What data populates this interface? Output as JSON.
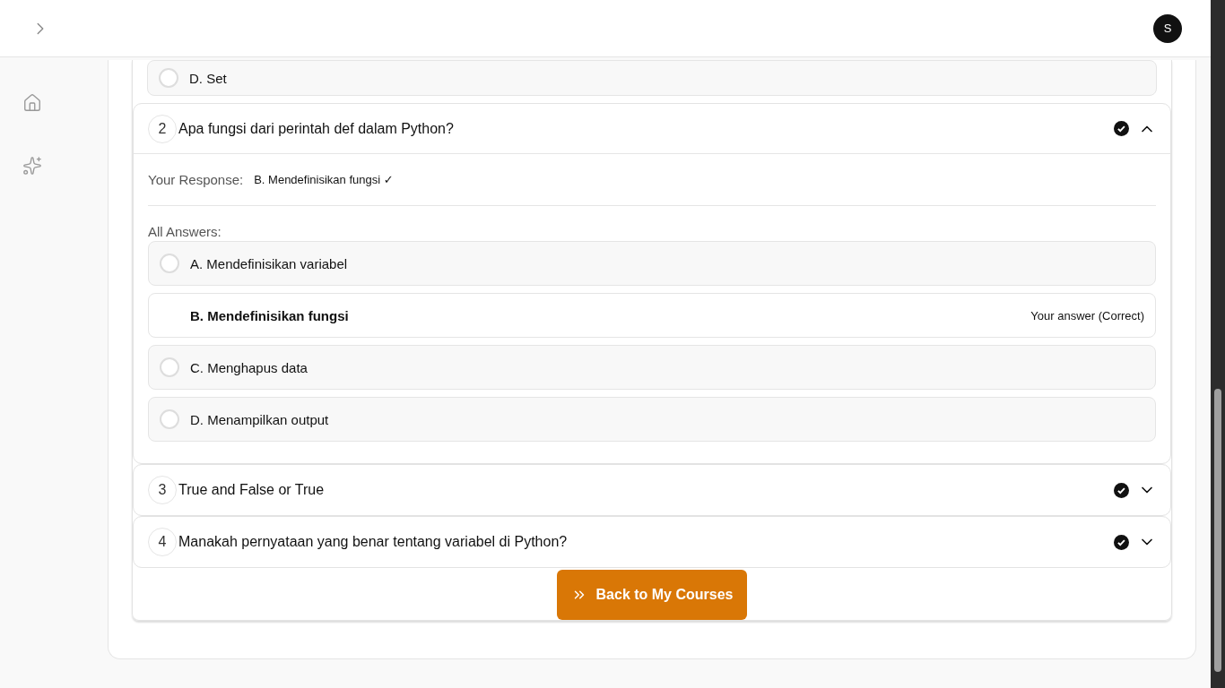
{
  "header": {
    "avatar": "S"
  },
  "sidebar": {
    "items": [
      {
        "kind": "home",
        "selected": false
      },
      {
        "kind": "sparkles",
        "selected": false
      }
    ]
  },
  "previous_question": {
    "options": [
      {
        "label": "D. Set",
        "selected": false
      }
    ]
  },
  "questions": [
    {
      "number": "2",
      "title": "Apa fungsi dari perintah def dalam Python?",
      "answered": true,
      "expanded": true,
      "response_label": "Your Response:",
      "response": "B. Mendefinisikan fungsi ✓",
      "answers_label": "All Answers:",
      "options": [
        {
          "label": "A. Mendefinisikan variabel",
          "selected": false
        },
        {
          "label": "B. Mendefinisikan fungsi",
          "selected": true,
          "note": "Your answer (Correct)"
        },
        {
          "label": "C. Menghapus data",
          "selected": false
        },
        {
          "label": "D. Menampilkan output",
          "selected": false
        }
      ]
    },
    {
      "number": "3",
      "title": "True and False or True",
      "answered": true,
      "expanded": false
    },
    {
      "number": "4",
      "title": "Manakah pernyataan yang benar tentang variabel di Python?",
      "answered": true,
      "expanded": false
    }
  ],
  "back_button": {
    "label": "Back to My Courses"
  }
}
